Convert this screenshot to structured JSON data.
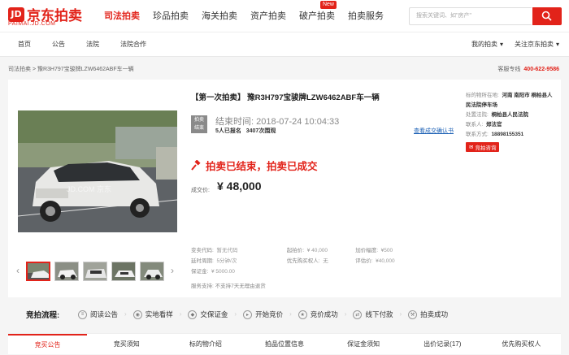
{
  "header": {
    "logo_mark": "JD",
    "logo_text": "京东拍卖",
    "logo_sub": "PAIMAI.JD.COM",
    "nav": [
      {
        "label": "司法拍卖",
        "active": true
      },
      {
        "label": "珍品拍卖"
      },
      {
        "label": "海关拍卖"
      },
      {
        "label": "资产拍卖"
      },
      {
        "label": "破产拍卖",
        "badge": "New"
      },
      {
        "label": "拍卖服务"
      }
    ],
    "search_placeholder": "搜索关键词、如\"房产\""
  },
  "subnav": {
    "links": [
      "首页",
      "公告",
      "法院",
      "法院合作"
    ],
    "my_auction": "我的拍卖",
    "follow": "关注京东拍卖"
  },
  "breadcrumb": "司法拍卖 > 豫R3H797宝骏牌LZW6462ABF车一辆",
  "hotline": {
    "label": "客服专线",
    "number": "400-622-9586"
  },
  "item": {
    "title": "【第一次拍卖】 豫R3H797宝骏牌LZW6462ABF车一辆",
    "state_badge": [
      "拍卖",
      "结束"
    ],
    "end_time": "结束时间: 2018-07-24 10:04:33",
    "signup_count": "5人已报名",
    "views": "3407次围观",
    "remind_link": "查看成交确认书",
    "result": "拍卖已结束，拍卖已成交",
    "price_label": "成交价:",
    "price": "¥ 48,000"
  },
  "meta": {
    "rows": [
      [
        {
          "k": "变卖代码:",
          "v": "暂无代码"
        },
        {
          "k": "起拍价:",
          "v": "¥ 40,000"
        },
        {
          "k": "加价幅度:",
          "v": "¥500",
          "red": true
        }
      ],
      [
        {
          "k": "延时周期:",
          "v": "5分钟/次"
        },
        {
          "k": "优先购买权人:",
          "v": "无"
        },
        {
          "k": "评估价:",
          "v": "¥40,000"
        }
      ],
      [
        {
          "k": "保证金:",
          "v": "¥ 5000.00"
        }
      ]
    ],
    "service": "服务支持:   不支持7天无理由退货"
  },
  "side": {
    "location_label": "标的物所在地:",
    "location": "河南 南阳市 桐柏县人民法院停车场",
    "court_label": "处置法院:",
    "court": "桐柏县人民法院",
    "contact_label": "联系人:",
    "contact": "郑法官",
    "phone_label": "联系方式:",
    "phone": "18898155351",
    "consult": "竞拍咨询"
  },
  "flow": {
    "label": "竞拍流程:",
    "steps": [
      "阅读公告",
      "实地看样",
      "交保证金",
      "开始竞价",
      "竞价成功",
      "线下付款",
      "拍卖成功"
    ]
  },
  "tabs": [
    {
      "label": "竞买公告",
      "active": true
    },
    {
      "label": "竞买须知"
    },
    {
      "label": "标的物介绍"
    },
    {
      "label": "拍品位置信息"
    },
    {
      "label": "保证金须知"
    },
    {
      "label": "出价记录(17)"
    },
    {
      "label": "优先购买权人"
    }
  ],
  "colors": {
    "brand": "#e2231a"
  }
}
